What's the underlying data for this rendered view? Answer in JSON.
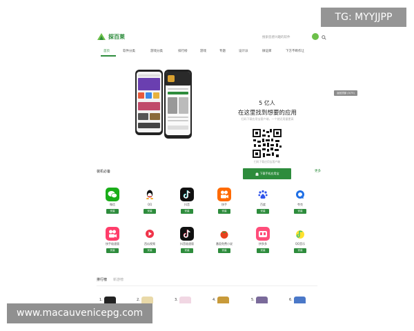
{
  "header": {
    "logo_text": "探百莱",
    "search_placeholder": "搜索您感兴趣的软件",
    "brand_color": "#2d8c3c"
  },
  "nav": {
    "items": [
      "首页",
      "软件分类",
      "游戏分类",
      "排行榜",
      "游戏",
      "专题",
      "设计派",
      "微证库",
      "下方不断作让"
    ],
    "active_index": 0
  },
  "hero": {
    "count": "5 亿人",
    "title": "在这里找到想要的应用",
    "subtitle": "扫码下载应用宝客户端，一个就近用量更高",
    "qr_caption": "扫码下载应用宝客户端",
    "download_label": "下载手机应用宝"
  },
  "essentials": {
    "title": "装机必备",
    "more": "更多",
    "apps": [
      {
        "name": "微信",
        "icon": "wechat-icon",
        "color": "#1aad19",
        "button": "安装"
      },
      {
        "name": "QQ",
        "icon": "qq-icon",
        "color": "#ffffff",
        "button": "安装"
      },
      {
        "name": "抖音",
        "icon": "douyin-icon",
        "color": "#111111",
        "button": "安装"
      },
      {
        "name": "快手",
        "icon": "kuaishou-icon",
        "color": "#ff6a00",
        "button": "安装"
      },
      {
        "name": "百度",
        "icon": "baidu-icon",
        "color": "#ffffff",
        "button": "安装"
      },
      {
        "name": "夸克",
        "icon": "quark-icon",
        "color": "#ffffff",
        "button": "安装"
      },
      {
        "name": "快手极速版",
        "icon": "kuaishou-lite-icon",
        "color": "#ff6a00",
        "button": "安装"
      },
      {
        "name": "西瓜视频",
        "icon": "xigua-icon",
        "color": "#ffffff",
        "button": "安装"
      },
      {
        "name": "抖音极速版",
        "icon": "douyin-lite-icon",
        "color": "#111111",
        "button": "安装"
      },
      {
        "name": "番茄免费小说",
        "icon": "fanqie-icon",
        "color": "#ffffff",
        "button": "安装"
      },
      {
        "name": "拼多多",
        "icon": "pinduoduo-icon",
        "color": "#ff4d7a",
        "button": "安装"
      },
      {
        "name": "QQ音乐",
        "icon": "qqmusic-icon",
        "color": "#ffffff",
        "button": "安装"
      }
    ]
  },
  "ranking": {
    "tabs": [
      "排行榜",
      "新游榜"
    ],
    "active_tab": 0,
    "items": [
      {
        "rank": "1.",
        "icon": "rank-app-1-icon",
        "color": "#222222"
      },
      {
        "rank": "2.",
        "icon": "rank-app-2-icon",
        "color": "#e9d9a8"
      },
      {
        "rank": "3.",
        "icon": "rank-app-3-icon",
        "color": "#f1d7e3"
      },
      {
        "rank": "4.",
        "icon": "rank-app-4-icon",
        "color": "#c89a3a"
      },
      {
        "rank": "5.",
        "icon": "rank-app-5-icon",
        "color": "#7a6a9a"
      },
      {
        "rank": "6.",
        "icon": "rank-app-6-icon",
        "color": "#4a78c8"
      }
    ]
  },
  "overlays": {
    "tg": "TG: MYYJJPP",
    "tooltip": "返回顶部 (0/75)",
    "url": "www.macauvenicepg.com"
  }
}
